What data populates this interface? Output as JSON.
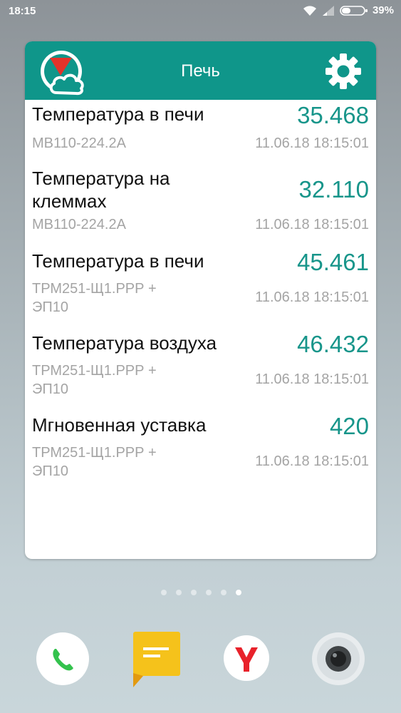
{
  "status_bar": {
    "time": "18:15",
    "battery": "39%"
  },
  "widget": {
    "title": "Печь",
    "colors": {
      "header": "#0f968a",
      "value": "#17958a"
    },
    "rows": [
      {
        "name_lines": [
          "Температура в печи"
        ],
        "value": "35.468",
        "device_lines": [
          "МВ110-224.2А"
        ],
        "time": "11.06.18 18:15:01"
      },
      {
        "name_lines": [
          "Температура на",
          "клеммах"
        ],
        "value": "32.110",
        "device_lines": [
          "МВ110-224.2А"
        ],
        "time": "11.06.18 18:15:01"
      },
      {
        "name_lines": [
          "Температура в печи"
        ],
        "value": "45.461",
        "device_lines": [
          "ТРМ251-Щ1.РРР +",
          "ЭП10"
        ],
        "time": "11.06.18 18:15:01"
      },
      {
        "name_lines": [
          "Температура воздуха"
        ],
        "value": "46.432",
        "device_lines": [
          "ТРМ251-Щ1.РРР +",
          "ЭП10"
        ],
        "time": "11.06.18 18:15:01"
      },
      {
        "name_lines": [
          "Мгновенная уставка"
        ],
        "value": "420",
        "device_lines": [
          "ТРМ251-Щ1.РРР +",
          "ЭП10"
        ],
        "time": "11.06.18 18:15:01"
      }
    ]
  },
  "home": {
    "page_count": 6,
    "active_page": 6,
    "dock": [
      "phone-icon",
      "notes-icon",
      "yandex-browser-icon",
      "camera-icon"
    ]
  }
}
